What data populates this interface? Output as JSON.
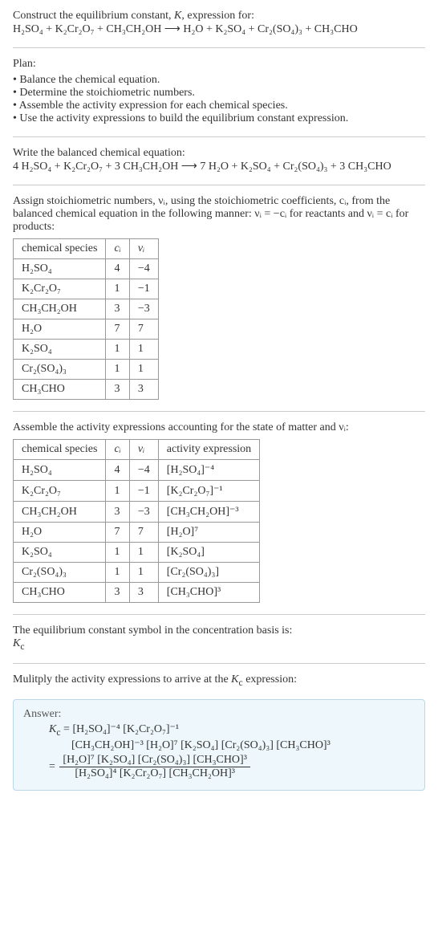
{
  "intro": {
    "line1": "Construct the equilibrium constant, K, expression for:",
    "equation": "H₂SO₄ + K₂Cr₂O₇ + CH₃CH₂OH  ⟶  H₂O + K₂SO₄ + Cr₂(SO₄)₃ + CH₃CHO"
  },
  "plan": {
    "heading": "Plan:",
    "items": [
      "Balance the chemical equation.",
      "Determine the stoichiometric numbers.",
      "Assemble the activity expression for each chemical species.",
      "Use the activity expressions to build the equilibrium constant expression."
    ]
  },
  "balanced": {
    "heading": "Write the balanced chemical equation:",
    "equation": "4 H₂SO₄ + K₂Cr₂O₇ + 3 CH₃CH₂OH  ⟶  7 H₂O + K₂SO₄ + Cr₂(SO₄)₃ + 3 CH₃CHO"
  },
  "stoich": {
    "text": "Assign stoichiometric numbers, νᵢ, using the stoichiometric coefficients, cᵢ, from the balanced chemical equation in the following manner: νᵢ = −cᵢ for reactants and νᵢ = cᵢ for products:",
    "headers": [
      "chemical species",
      "cᵢ",
      "νᵢ"
    ],
    "rows": [
      [
        "H₂SO₄",
        "4",
        "−4"
      ],
      [
        "K₂Cr₂O₇",
        "1",
        "−1"
      ],
      [
        "CH₃CH₂OH",
        "3",
        "−3"
      ],
      [
        "H₂O",
        "7",
        "7"
      ],
      [
        "K₂SO₄",
        "1",
        "1"
      ],
      [
        "Cr₂(SO₄)₃",
        "1",
        "1"
      ],
      [
        "CH₃CHO",
        "3",
        "3"
      ]
    ]
  },
  "activity": {
    "text": "Assemble the activity expressions accounting for the state of matter and νᵢ:",
    "headers": [
      "chemical species",
      "cᵢ",
      "νᵢ",
      "activity expression"
    ],
    "rows": [
      [
        "H₂SO₄",
        "4",
        "−4",
        "[H₂SO₄]⁻⁴"
      ],
      [
        "K₂Cr₂O₇",
        "1",
        "−1",
        "[K₂Cr₂O₇]⁻¹"
      ],
      [
        "CH₃CH₂OH",
        "3",
        "−3",
        "[CH₃CH₂OH]⁻³"
      ],
      [
        "H₂O",
        "7",
        "7",
        "[H₂O]⁷"
      ],
      [
        "K₂SO₄",
        "1",
        "1",
        "[K₂SO₄]"
      ],
      [
        "Cr₂(SO₄)₃",
        "1",
        "1",
        "[Cr₂(SO₄)₃]"
      ],
      [
        "CH₃CHO",
        "3",
        "3",
        "[CH₃CHO]³"
      ]
    ]
  },
  "symbol": {
    "text": "The equilibrium constant symbol in the concentration basis is:",
    "sym": "K_c"
  },
  "multiply": {
    "text": "Mulitply the activity expressions to arrive at the K_c expression:"
  },
  "answer": {
    "label": "Answer:",
    "line1": "K_c = [H₂SO₄]⁻⁴ [K₂Cr₂O₇]⁻¹",
    "line2": "[CH₃CH₂OH]⁻³ [H₂O]⁷ [K₂SO₄] [Cr₂(SO₄)₃] [CH₃CHO]³",
    "frac_num": "[H₂O]⁷ [K₂SO₄] [Cr₂(SO₄)₃] [CH₃CHO]³",
    "frac_den": "[H₂SO₄]⁴ [K₂Cr₂O₇] [CH₃CH₂OH]³",
    "eq_sign": "="
  }
}
